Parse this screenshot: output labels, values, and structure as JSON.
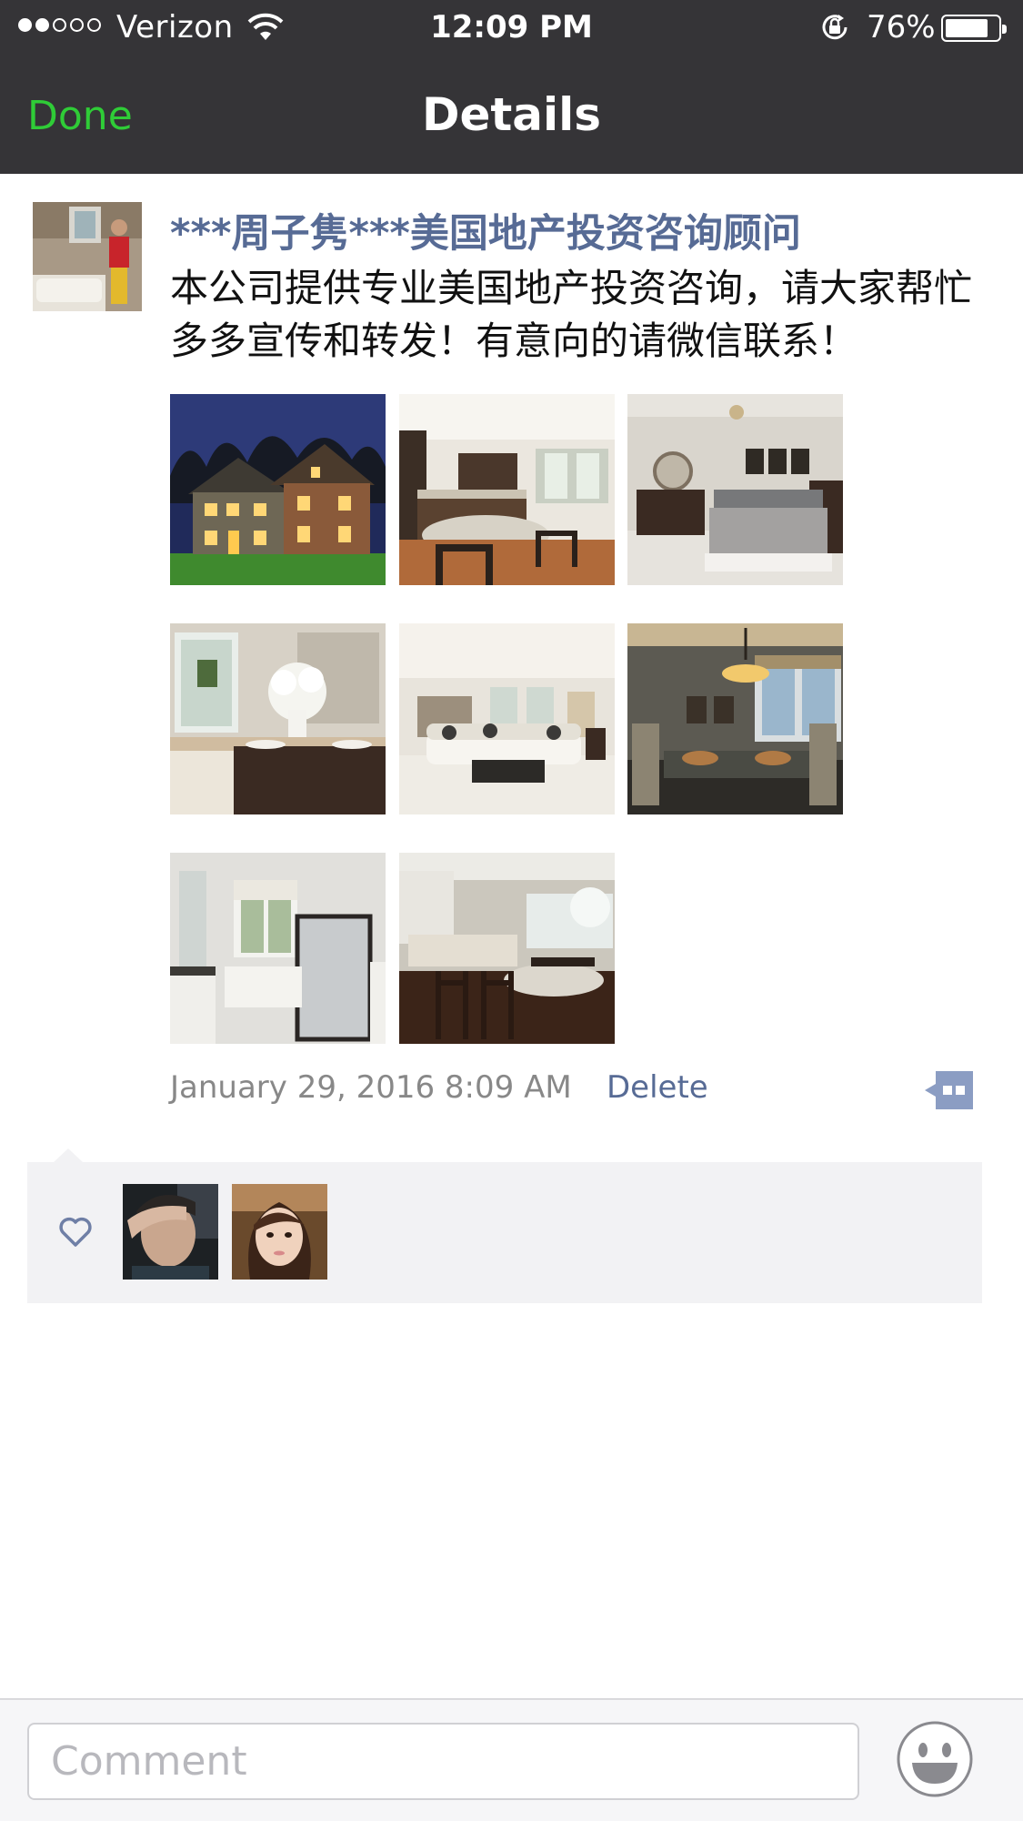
{
  "status_bar": {
    "carrier": "Verizon",
    "time": "12:09 PM",
    "battery_percent": "76%",
    "battery_level": 0.76,
    "signal_bars_filled": 2,
    "signal_bars_total": 5
  },
  "nav": {
    "done_label": "Done",
    "title": "Details"
  },
  "post": {
    "author": "***周子隽***美国地产投资咨询顾问",
    "text": "本公司提供专业美国地产投资咨询，请大家帮忙多多宣传和转发！有意向的请微信联系！",
    "photo_count": 8,
    "timestamp": "January 29, 2016 8:09 AM",
    "delete_label": "Delete"
  },
  "likes": {
    "count": 2
  },
  "comment": {
    "placeholder": "Comment"
  },
  "colors": {
    "nav_background": "#353437",
    "done_green": "#2fcc37",
    "link_blue": "#576b95",
    "likes_background": "#f2f2f4"
  }
}
